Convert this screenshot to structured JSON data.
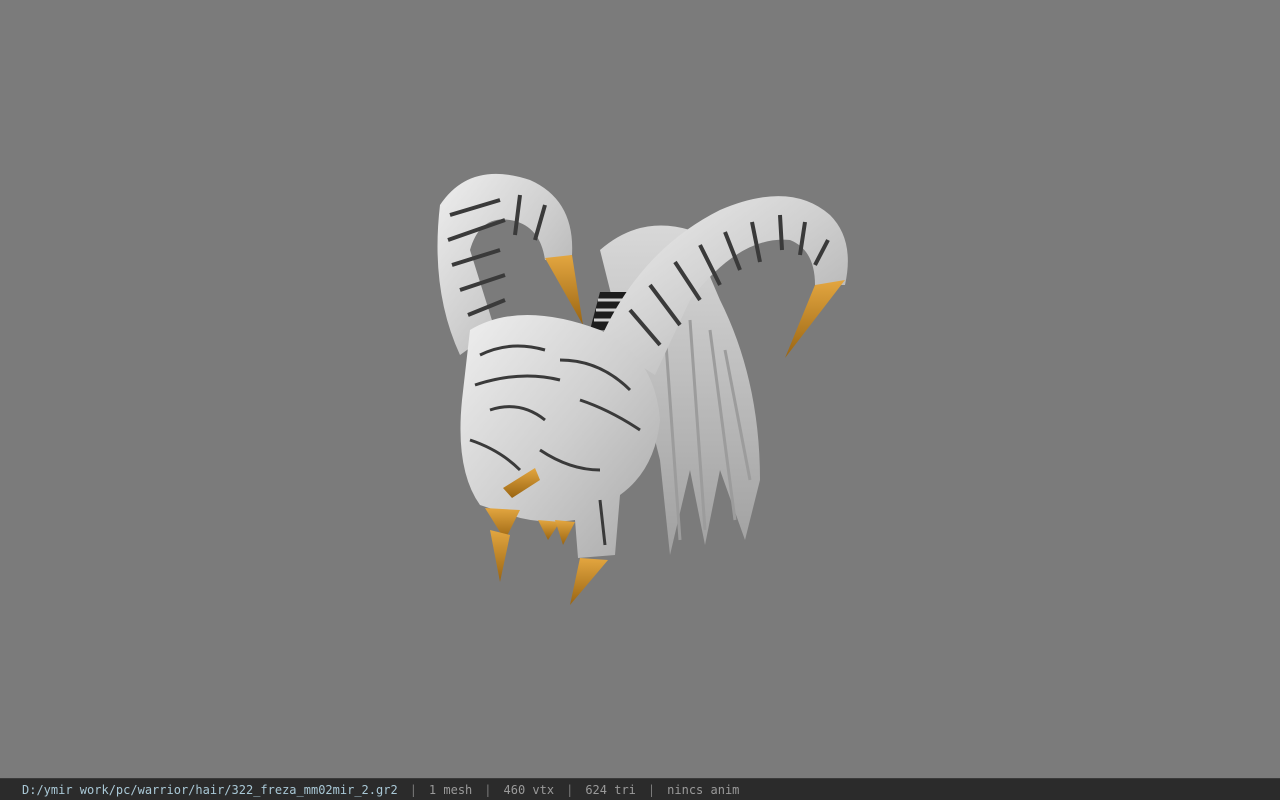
{
  "status": {
    "path": "D:/ymir work/pc/warrior/hair/322_freza_mm02mir_2.gr2",
    "separator": "|",
    "mesh": "1 mesh",
    "vertices": "460 vtx",
    "triangles": "624 tri",
    "animation": "nincs anim"
  },
  "colors": {
    "background": "#7b7b7b",
    "horn": "#d6d6d6",
    "horn_stripe": "#3a3a3a",
    "tip": "#c98a25",
    "status_bar": "#2b2b2b",
    "path_text": "#a9c8d6"
  },
  "viewport": {
    "model_icon": "horned-helmet-model"
  }
}
